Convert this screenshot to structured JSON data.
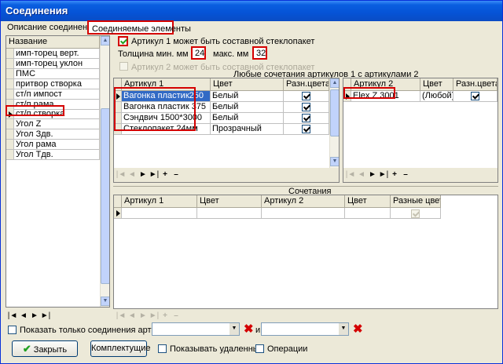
{
  "window": {
    "title": "Соединения"
  },
  "tabs": [
    {
      "label": "Описание соединений"
    },
    {
      "label": "Соединяемые элементы"
    }
  ],
  "left_list": {
    "header": "Название",
    "items": [
      "имп-торец верт.",
      "имп-торец уклон",
      "ПМС",
      "притвор створка",
      "ст/п импост",
      "ст/п рама",
      "ст/п створка",
      "Угол Z",
      "Угол Здв.",
      "Угол рама",
      "Угол Тдв."
    ],
    "selected_index": 6
  },
  "options": {
    "article1_composite": "Артикул 1 может быть составной стеклопакет",
    "article1_composite_checked": true,
    "thickness_min_label": "Толщина мин. мм",
    "thickness_min": "24",
    "thickness_max_label": "макс. мм",
    "thickness_max": "32",
    "article2_composite": "Артикул 2 может быть составной стеклопакет",
    "article2_composite_checked": false
  },
  "combos_title": "Любые сочетания артикулов 1 с артикулами 2",
  "grid1": {
    "headers": [
      "Артикул 1",
      "Цвет",
      "Разн.цвета"
    ],
    "rows": [
      {
        "article": "Вагонка пластик250",
        "color": "Белый",
        "diff": true
      },
      {
        "article": "Вагонка пластик 375",
        "color": "Белый",
        "diff": true
      },
      {
        "article": "Сэндвич 1500*3000",
        "color": "Белый",
        "diff": true
      },
      {
        "article": "Стеклопакет 24мм",
        "color": "Прозрачный",
        "diff": true
      }
    ]
  },
  "grid2": {
    "headers": [
      "Артикул 2",
      "Цвет",
      "Разн.цвета"
    ],
    "rows": [
      {
        "article": "Elex Z 3001",
        "color": "(Любой)",
        "diff": true
      }
    ]
  },
  "grid3": {
    "title": "Сочетания",
    "headers": [
      "Артикул 1",
      "Цвет",
      "Артикул 2",
      "Цвет",
      "Разные цвета"
    ]
  },
  "nav": {
    "first": "|◄",
    "prev": "◄",
    "next": "►",
    "last": "►|",
    "add": "+",
    "del": "–"
  },
  "bottom": {
    "only_links_label": "Показать только соединения артикулов",
    "and_label": "и",
    "close_button": "Закрыть",
    "kit_button": "Комплектущие",
    "show_deleted": "Показывать удаленные",
    "operations": "Операции"
  },
  "colors": {
    "highlight": "#d40000",
    "selection": "#316ac5",
    "titlebar": "#0553d6"
  },
  "icons": [
    "checkmark-icon",
    "close-x-icon",
    "row-pointer-icon",
    "dropdown-arrow-icon"
  ]
}
